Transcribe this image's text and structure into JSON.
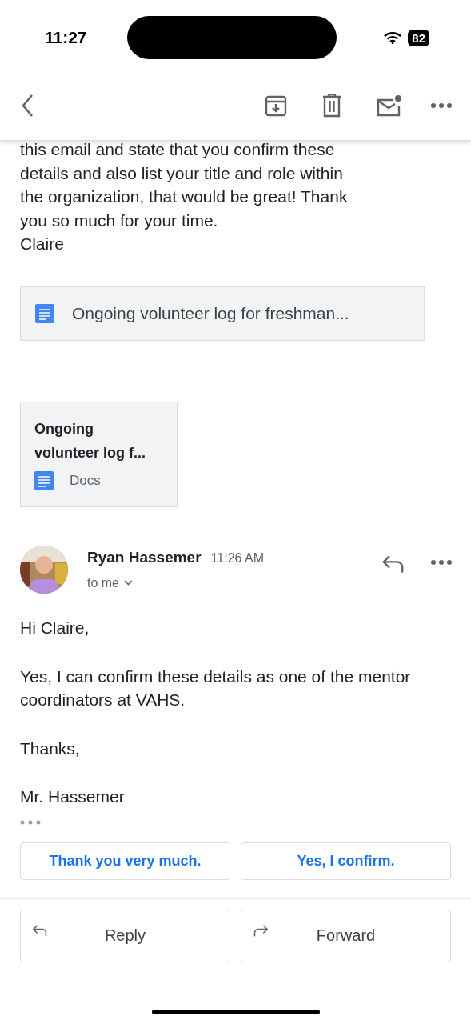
{
  "status_bar": {
    "time": "11:27",
    "battery": "82"
  },
  "message_tail": "this email and state that you confirm these\ndetails and also list your title and role within\nthe organization, that would be great! Thank\nyou so much for your time.\nClaire",
  "attachment_chip": {
    "label": "Ongoing volunteer log for freshman..."
  },
  "attachment_card": {
    "title": "Ongoing\nvolunteer log f...",
    "type": "Docs"
  },
  "reply_message": {
    "sender": "Ryan Hassemer",
    "time": "11:26 AM",
    "recipient": "to me",
    "body": [
      "Hi Claire,",
      "Yes, I can confirm these details as one of the mentor coordinators at VAHS.",
      "Thanks,",
      "Mr. Hassemer"
    ]
  },
  "smart_replies": [
    "Thank you very much.",
    "Yes, I confirm."
  ],
  "actions": [
    {
      "kind": "reply",
      "label": "Reply"
    },
    {
      "kind": "forward",
      "label": "Forward"
    }
  ]
}
